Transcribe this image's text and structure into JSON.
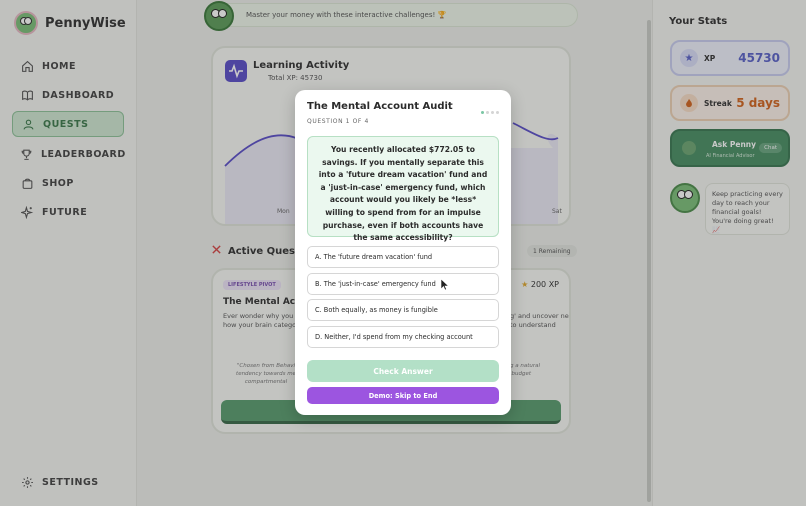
{
  "brand": {
    "name": "PennyWise"
  },
  "nav": {
    "items": [
      {
        "label": "HOME",
        "icon": "home-icon"
      },
      {
        "label": "DASHBOARD",
        "icon": "book-icon"
      },
      {
        "label": "QUESTS",
        "icon": "user-icon",
        "active": true
      },
      {
        "label": "LEADERBOARD",
        "icon": "trophy-icon"
      },
      {
        "label": "SHOP",
        "icon": "bag-icon"
      },
      {
        "label": "FUTURE",
        "icon": "sparkle-icon"
      }
    ],
    "settings": "SETTINGS"
  },
  "topbar": {
    "message": "Master your money with these interactive challenges! 🏆"
  },
  "activity": {
    "title": "Learning Activity",
    "subtitle": "Total XP: 45730",
    "x_start": "Mon",
    "x_end": "Sat"
  },
  "quests": {
    "heading": "Active Quests",
    "badge": "1 Remaining",
    "card": {
      "tag": "LIFESTYLE PIVOT",
      "xp": "200 XP",
      "title": "The Mental Accou",
      "desc_left": "Ever wonder why you tr how your brain categori",
      "desc_right": "g' and uncover ne to understand",
      "quote_left": "\"Chosen from Behavi tendency towards me compartmental",
      "quote_right": "g a natural 'budget"
    }
  },
  "stats": {
    "title": "Your Stats",
    "xp_label": "XP",
    "xp_value": "45730",
    "streak_label": "Streak",
    "streak_value": "5 days",
    "penny_name": "Ask Penny",
    "penny_sub": "AI Financial Advisor",
    "penny_chat": "Chat",
    "tip": "Keep practicing every day to reach your financial goals! You're doing great! 📈"
  },
  "modal": {
    "title": "The Mental Account Audit",
    "progress": "QUESTION 1 OF 4",
    "question": "You recently allocated $772.05 to savings. If you mentally separate this into a 'future dream vacation' fund and a 'just-in-case' emergency fund, which account would you likely be *less* willing to spend from for an impulse purchase, even if both accounts have the same accessibility?",
    "options": [
      "A. The 'future dream vacation' fund",
      "B. The 'just-in-case' emergency fund",
      "C. Both equally, as money is fungible",
      "D. Neither, I'd spend from my checking account"
    ],
    "check_label": "Check Answer",
    "skip_label": "Demo: Skip to End"
  },
  "colors": {
    "accent_green": "#5a9c6f",
    "accent_purple": "#9c55e0",
    "xp_blue": "#5b63c9",
    "streak_orange": "#d2651f"
  }
}
